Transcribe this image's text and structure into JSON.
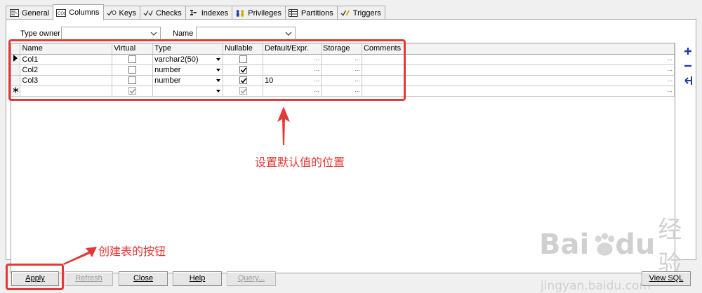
{
  "tabs": [
    {
      "label": "General",
      "icon": "general-icon"
    },
    {
      "label": "Columns",
      "icon": "columns-icon",
      "active": true
    },
    {
      "label": "Keys",
      "icon": "keys-icon"
    },
    {
      "label": "Checks",
      "icon": "checks-icon"
    },
    {
      "label": "Indexes",
      "icon": "indexes-icon"
    },
    {
      "label": "Privileges",
      "icon": "privileges-icon"
    },
    {
      "label": "Partitions",
      "icon": "partitions-icon"
    },
    {
      "label": "Triggers",
      "icon": "triggers-icon"
    }
  ],
  "filters": {
    "type_owner_label": "Type owner",
    "type_owner_value": "",
    "name_label": "Name",
    "name_value": ""
  },
  "grid": {
    "headers": [
      "Name",
      "Virtual",
      "Type",
      "Nullable",
      "Default/Expr.",
      "Storage",
      "Comments"
    ],
    "rows": [
      {
        "name": "Col1",
        "virtual": false,
        "type": "varchar2(50)",
        "nullable": false,
        "default": "",
        "storage": "",
        "comments": "",
        "current": true
      },
      {
        "name": "Col2",
        "virtual": false,
        "type": "number",
        "nullable": true,
        "default": "",
        "storage": "",
        "comments": ""
      },
      {
        "name": "Col3",
        "virtual": false,
        "type": "number",
        "nullable": true,
        "default": "10",
        "storage": "",
        "comments": ""
      },
      {
        "name": "",
        "virtual": true,
        "type": "",
        "nullable": true,
        "default": "",
        "storage": "",
        "comments": "",
        "new": true
      }
    ],
    "ellipsis": "..."
  },
  "annotations": {
    "default_position": "设置默认值的位置",
    "create_button": "创建表的按钮"
  },
  "buttons": {
    "apply": "Apply",
    "refresh": "Refresh",
    "close": "Close",
    "help": "Help",
    "query": "Query...",
    "view_sql": "View SQL"
  },
  "watermark": {
    "brand": "Bai",
    "brand2": "du",
    "brand_cn": "经验",
    "url": "jingyan.baidu.com"
  },
  "colors": {
    "highlight": "#e53935",
    "tool_blue": "#1f3fa8"
  }
}
